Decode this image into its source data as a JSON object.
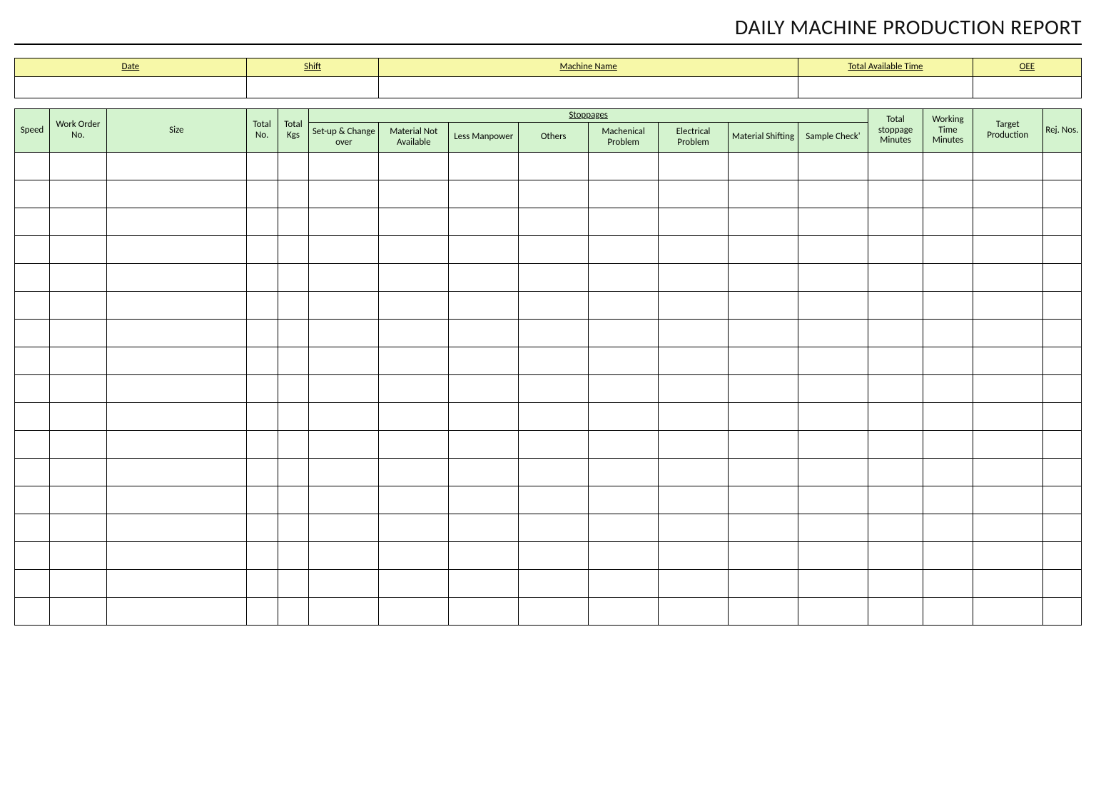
{
  "title": "DAILY MACHINE PRODUCTION REPORT",
  "info_headers": {
    "date": "Date",
    "shift": "Shift",
    "machine_name": "Machine Name",
    "total_available_time": "Total Available Time",
    "oee": "OEE"
  },
  "info_values": {
    "date": "",
    "shift": "",
    "machine_name": "",
    "total_available_time": "",
    "oee": ""
  },
  "columns": {
    "speed": "Speed",
    "work_order_no": "Work Order No.",
    "size": "Size",
    "total_no": "Total No.",
    "total_kgs": "Total Kgs",
    "stoppages_group": "Stoppages",
    "stoppages": {
      "setup_changeover": "Set-up & Change over",
      "material_not_available": "Material Not Available",
      "less_manpower": "Less Manpower",
      "others": "Others",
      "mechanical_problem": "Machenical Problem",
      "electrical_problem": "Electrical Problem",
      "material_shifting": "Material Shifting",
      "sample_check": "Sample Check'"
    },
    "total_stoppage_minutes": "Total stoppage Minutes",
    "working_time_minutes": "Working Time Minutes",
    "target_production": "Target Production",
    "rej_nos": "Rej. Nos."
  },
  "data_row_count": 17
}
